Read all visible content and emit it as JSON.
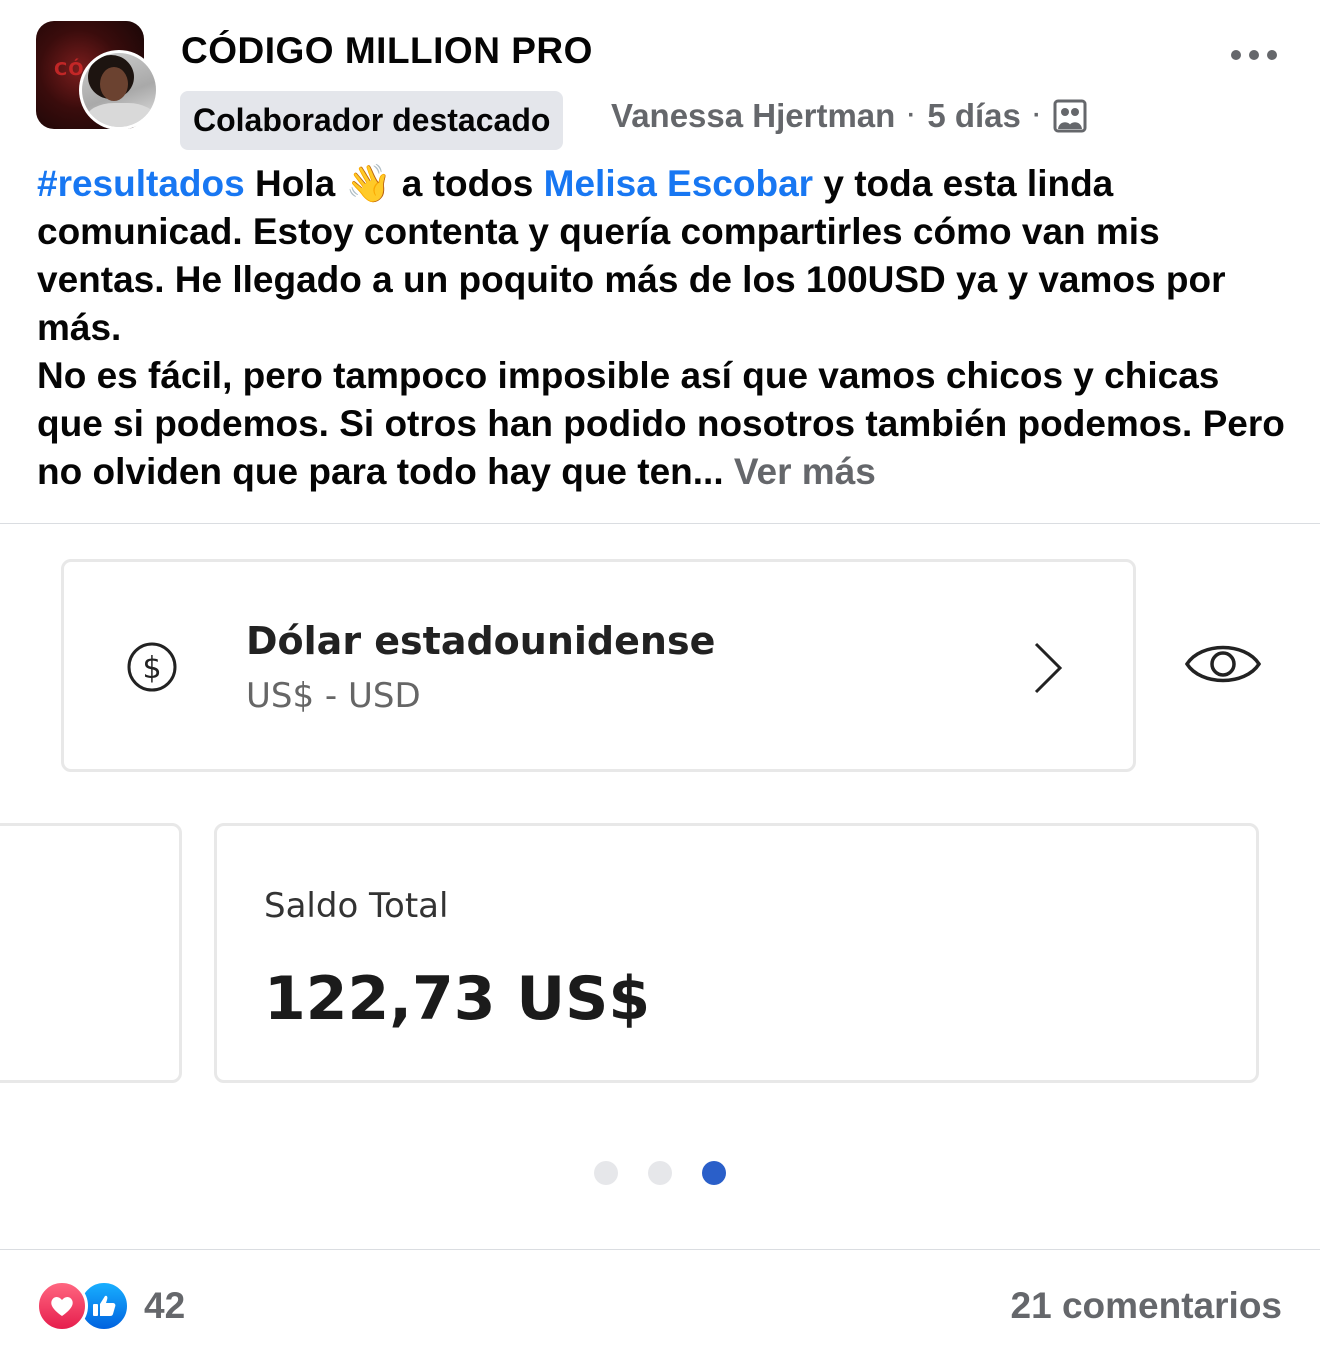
{
  "header": {
    "group_name": "CÓDIGO MILLION PRO",
    "group_avatar_text": "CÓ MIL",
    "badge": "Colaborador destacado",
    "author": "Vanessa Hjertman",
    "separator": "·",
    "time": "5 días",
    "audience_icon": "group-privacy-icon",
    "more_icon": "more-options-icon"
  },
  "post": {
    "hashtag": "#resultados",
    "line1_text": " Hola ",
    "emoji": "👋",
    "line1_after": " a todos ",
    "mention": "Melisa Escobar",
    "paragraph1_rest": " y toda esta linda comunicad. Estoy contenta y quería compartirles cómo van mis ventas. He llegado a un poquito más de los 100USD ya y vamos por más.",
    "paragraph2": "No es fácil, pero tampoco imposible así que vamos chicos y chicas que si podemos. Si otros han podido nosotros también podemos. Pero no olviden que para todo hay que ten... ",
    "see_more": "Ver más"
  },
  "image": {
    "currency_name": "Dólar estadounidense",
    "currency_code": "US$ - USD",
    "balance_label": "Saldo Total",
    "balance_value": "122,73 US$",
    "dots_total": 3,
    "active_dot": 3,
    "accent_color": "#2a5fc9"
  },
  "footer": {
    "reactions": [
      "love",
      "like"
    ],
    "reaction_count": "42",
    "comments": "21 comentarios"
  },
  "colors": {
    "link": "#1877f2",
    "secondary_text": "#65676b",
    "badge_bg": "#e4e6eb"
  }
}
